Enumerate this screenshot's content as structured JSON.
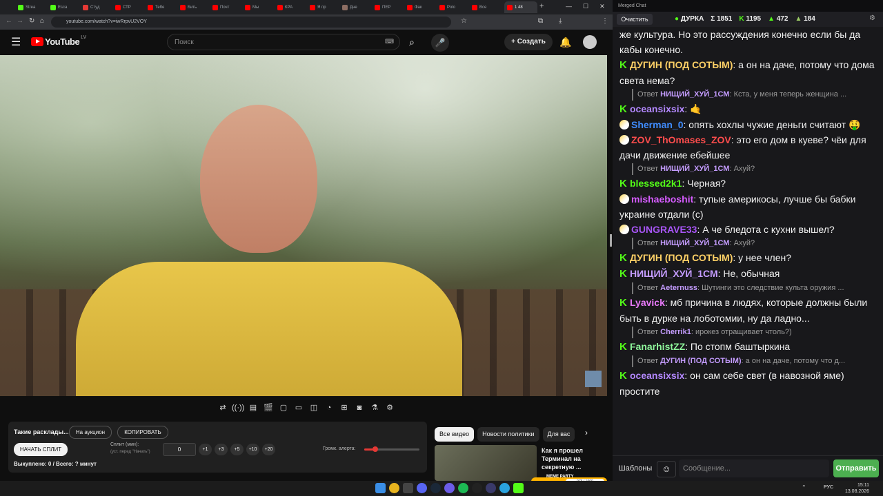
{
  "browser": {
    "tabs": [
      {
        "label": "Strea",
        "color": "#53fc18"
      },
      {
        "label": "Esca",
        "color": "#53fc18"
      },
      {
        "label": "Студ",
        "color": "#e53935"
      },
      {
        "label": "СТР",
        "color": "#ff0000"
      },
      {
        "label": "Тебе",
        "color": "#ff0000"
      },
      {
        "label": "Бить",
        "color": "#ff0000"
      },
      {
        "label": "Почт",
        "color": "#ff0000"
      },
      {
        "label": "Мы",
        "color": "#ff0000"
      },
      {
        "label": "КРА",
        "color": "#ff0000"
      },
      {
        "label": "Я пр",
        "color": "#ff0000"
      },
      {
        "label": "Дне",
        "color": "#8d6e63"
      },
      {
        "label": "ПЕР",
        "color": "#ff0000"
      },
      {
        "label": "Фак",
        "color": "#ff0000"
      },
      {
        "label": "Polo",
        "color": "#ff0000"
      },
      {
        "label": "Все",
        "color": "#ff0000"
      },
      {
        "label": "1 48",
        "color": "#ff0000",
        "active": true
      }
    ],
    "new_tab": "+",
    "url": "youtube.com/watch?v=iwRrpvU2VOY"
  },
  "youtube": {
    "logo": "YouTube",
    "region": "LV",
    "search_placeholder": "Поиск",
    "create_label": "Создать"
  },
  "panel": {
    "title": "Такие расклады...",
    "auction_btn": "На аукцион",
    "copy_btn": "КОПИРОВАТЬ",
    "start_btn": "НАЧАТЬ СПЛИТ",
    "split_label": "Сплит (мин):",
    "split_hint": "(уст. перед \"Начать\")",
    "split_value": "0",
    "steps": [
      "+1",
      "+3",
      "+5",
      "+10",
      "+20"
    ],
    "volume_label": "Громк. алерта:",
    "volume_level": 0.2,
    "bought": "Выкуплено: 0 / Всего: ? минут"
  },
  "suggestions": {
    "chips": [
      "Все видео",
      "Новости политики",
      "Для вас"
    ],
    "card_title": "Как я прошел Терминал на секретную ...",
    "meme_badge": "MEME PARTY",
    "meme_progress": "976 / 1500"
  },
  "chat": {
    "window_title": "Merged Chat",
    "clear_label": "Очистить",
    "status": "ДУРКА",
    "stats": [
      {
        "icon": "Σ",
        "value": "1851"
      },
      {
        "icon": "K",
        "value": "1195"
      },
      {
        "icon": "▲",
        "value": "472"
      },
      {
        "icon": "▲",
        "value": "184"
      }
    ],
    "messages": [
      {
        "type": "text",
        "text": "же культура. Но это рассуждения конечно если бы да кабы конечно."
      },
      {
        "type": "msg",
        "platform": "kick",
        "user": "ДУГИН (ПОД СОТЫМ)",
        "color": "#ffd166",
        "text": "а он на даче, потому что дома света нема?"
      },
      {
        "type": "reply",
        "prefix": "Ответ",
        "ruser": "НИЩИЙ_ХУЙ_1СМ",
        "rcolor": "#c49cff",
        "text": "Кста, у меня теперь женщина ..."
      },
      {
        "type": "msg",
        "platform": "kick",
        "user": "oceansixsix",
        "color": "#b388ff",
        "text": "🤙"
      },
      {
        "type": "msg",
        "platform": "vk",
        "user": "Sherman_0",
        "color": "#3f8cff",
        "text": "опять хохлы чужие деньги считают 🤑"
      },
      {
        "type": "msg",
        "platform": "vk",
        "user": "ZOV_ThOmases_ZOV",
        "color": "#ff4d4d",
        "text": "это его дом в куеве? чёи для дачи движение ебейшее"
      },
      {
        "type": "reply",
        "prefix": "Ответ",
        "ruser": "НИЩИЙ_ХУЙ_1СМ",
        "rcolor": "#c49cff",
        "text": "Ахуй?"
      },
      {
        "type": "msg",
        "platform": "kick",
        "user": "blessed2k1",
        "color": "#53fc18",
        "text": "Черная?"
      },
      {
        "type": "msg",
        "platform": "vk",
        "user": "mishaeboshit",
        "color": "#d65cff",
        "text": "тупые америкосы, лучше бы бабки украине отдали (с)"
      },
      {
        "type": "msg",
        "platform": "vk",
        "user": "GUNGRAVE33",
        "color": "#a855f7",
        "text": "А че бледота с кухни вышел?"
      },
      {
        "type": "reply",
        "prefix": "Ответ",
        "ruser": "НИЩИЙ_ХУЙ_1СМ",
        "rcolor": "#c49cff",
        "text": "Ахуй?"
      },
      {
        "type": "msg",
        "platform": "kick",
        "user": "ДУГИН (ПОД СОТЫМ)",
        "color": "#ffd166",
        "text": "у нее член?"
      },
      {
        "type": "msg",
        "platform": "kick",
        "user": "НИЩИЙ_ХУЙ_1СМ",
        "color": "#c49cff",
        "text": "Не, обычная"
      },
      {
        "type": "reply",
        "prefix": "Ответ",
        "ruser": "Aeternuss",
        "rcolor": "#c49cff",
        "text": "Шутинги это следствие культа оружия ..."
      },
      {
        "type": "msg",
        "platform": "kick",
        "user": "Lyavick",
        "color": "#e879f9",
        "text": "мб причина в людях, которые должны были быть в дурке на лоботомии, ну да ладно..."
      },
      {
        "type": "reply",
        "prefix": "Ответ",
        "ruser": "Cherrik1",
        "rcolor": "#c49cff",
        "text": "ирокез отращивает чтоль?)"
      },
      {
        "type": "msg",
        "platform": "kick",
        "user": "FanarhistZZ",
        "color": "#8ef59b",
        "text": "По стопм баштыркина"
      },
      {
        "type": "reply",
        "prefix": "Ответ",
        "ruser": "ДУГИН (ПОД СОТЫМ)",
        "rcolor": "#c49cff",
        "text": "а он на даче, потому что д..."
      },
      {
        "type": "msg",
        "platform": "kick",
        "user": "oceansixsix",
        "color": "#b388ff",
        "text": "он сам себе свет (в навозной яме) простите"
      }
    ],
    "templates_label": "Шаблоны",
    "input_placeholder": "Сообщение...",
    "send_label": "Отправить"
  },
  "taskbar": {
    "lang": "РУС",
    "time": "15:11",
    "date": "13.08.2026"
  }
}
